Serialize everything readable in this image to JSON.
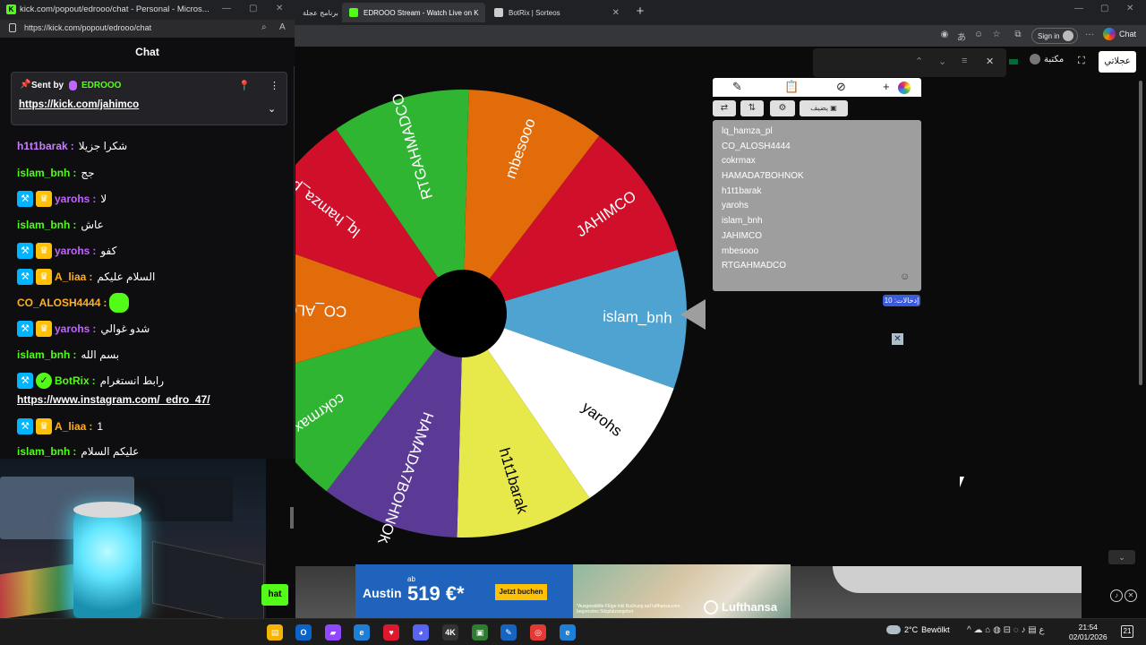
{
  "browser": {
    "tabs": [
      {
        "label": "برنامج عجلة",
        "active": false
      },
      {
        "label": "EDROOO Stream - Watch Live on K",
        "active": false
      },
      {
        "label": "BotRix | Sorteos",
        "active": false
      }
    ],
    "sign_in_label": "Sign in",
    "copilot_label": "Chat"
  },
  "page": {
    "library_label": "مكتبة",
    "urgent_label": "عجلاتي"
  },
  "wheel": {
    "segments": [
      {
        "label": "mbesooo",
        "color": "#e26b0a"
      },
      {
        "label": "JAHIMCO",
        "color": "#d0102b"
      },
      {
        "label": "islam_bnh",
        "color": "#4ea3d0"
      },
      {
        "label": "yarohs",
        "color": "#ffffff"
      },
      {
        "label": "h1t1barak",
        "color": "#e7e84a"
      },
      {
        "label": "HAMADA7BOHNOK",
        "color": "#5b3a96"
      },
      {
        "label": "cokrmax",
        "color": "#2fb532"
      },
      {
        "label": "CO_ALOSH4444",
        "color": "#e26b0a"
      },
      {
        "label": "lq_hamza_pl",
        "color": "#d0102b"
      },
      {
        "label": "RTGAHMADCO",
        "color": "#2fb532"
      }
    ],
    "add_image_label": "يضيف",
    "entries": [
      "lq_hamza_pl",
      "CO_ALOSH4444",
      "cokrmax",
      "HAMADA7BOHNOK",
      "h1t1barak",
      "yarohs",
      "islam_bnh",
      "JAHIMCO",
      "mbesooo",
      "RTGAHMADCO"
    ],
    "entries_count_label": "إدخالات: 10"
  },
  "ad": {
    "city": "Austin",
    "from_label": "ab",
    "price": "519 €*",
    "cta": "Jetzt buchen",
    "fine_print": "*Ausgewählte Flüge inkl Buchung auf lufthansa.com, begrenztes Sitzplatzangebot",
    "brand": "Lufthansa"
  },
  "chat_window": {
    "title": "kick.com/popout/edrooo/chat - Personal - Micros...",
    "url": "https://kick.com/popout/edrooo/chat",
    "header": "Chat",
    "pinned": {
      "sent_by_label": "Sent by",
      "user": "EDROOO",
      "link": "https://kick.com/jahimco"
    },
    "messages": [
      {
        "user": "h1t1barak",
        "color": "#c77dff",
        "text": "شكرا جزيلا",
        "badges": []
      },
      {
        "user": "islam_bnh",
        "color": "#53fc18",
        "text": "جج",
        "badges": []
      },
      {
        "user": "yarohs",
        "color": "#c264ff",
        "text": "لا",
        "badges": [
          "mod",
          "vip"
        ]
      },
      {
        "user": "islam_bnh",
        "color": "#53fc18",
        "text": "عاش",
        "badges": []
      },
      {
        "user": "yarohs",
        "color": "#c264ff",
        "text": "كفو",
        "badges": [
          "mod",
          "vip"
        ]
      },
      {
        "user": "A_liaa",
        "color": "#ffb020",
        "text": "السلام عليكم",
        "badges": [
          "mod",
          "vip"
        ]
      },
      {
        "user": "CO_ALOSH4444",
        "color": "#ffb020",
        "text": "",
        "badges": [],
        "emote": true
      },
      {
        "user": "yarohs",
        "color": "#c264ff",
        "text": "شدو غوالي",
        "badges": [
          "mod",
          "vip"
        ]
      },
      {
        "user": "islam_bnh",
        "color": "#53fc18",
        "text": "بسم الله",
        "badges": []
      },
      {
        "user": "BotRix",
        "color": "#53fc18",
        "text": "رابط انستغرام",
        "badges": [
          "mod",
          "verified"
        ]
      },
      {
        "user": "A_liaa",
        "color": "#ffb020",
        "text": "1",
        "badges": [
          "mod",
          "vip"
        ]
      },
      {
        "user": "islam_bnh",
        "color": "#53fc18",
        "text": "عليكم السلام",
        "badges": []
      }
    ],
    "botrix_link": "https://www.instagram.com/_edro_47/",
    "send_label": "hat"
  },
  "taskbar": {
    "weather_temp": "2°C",
    "weather_text": "Bewölkt",
    "time": "21:54",
    "date": "02/01/2026",
    "notification_count": "21"
  }
}
